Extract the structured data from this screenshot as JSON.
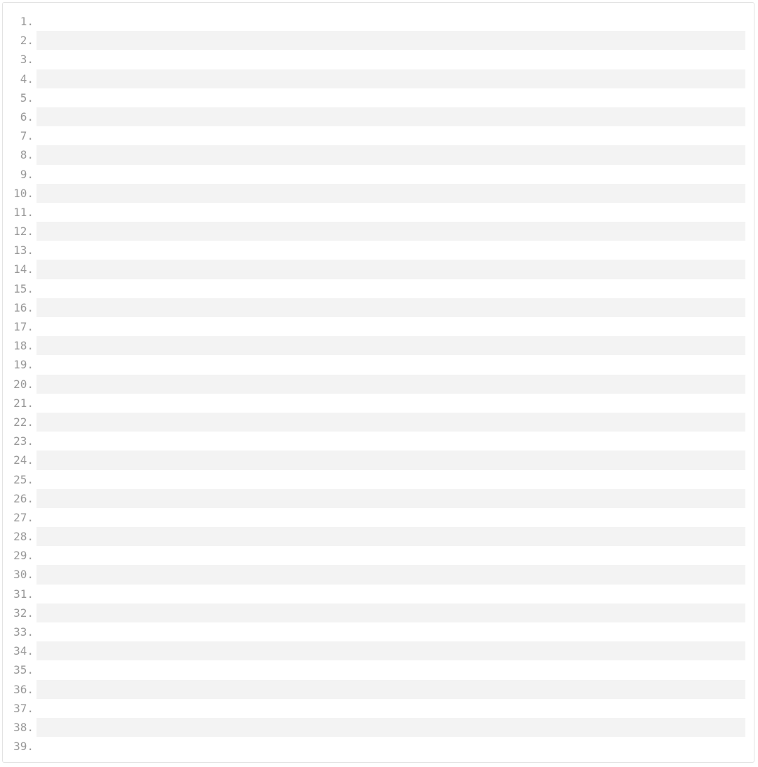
{
  "theme": {
    "text_color": "#222222",
    "line_number_color": "#999999",
    "stripe_color": "#f3f3f3"
  },
  "code": {
    "lines": [
      "",
      "",
      "",
      "",
      "",
      "",
      "",
      "",
      "",
      "",
      "",
      "",
      "",
      "",
      "",
      "",
      "",
      "",
      "",
      "",
      "",
      "",
      "",
      "",
      "",
      "",
      "",
      "",
      "",
      "",
      "",
      "",
      "",
      "",
      "",
      "",
      "",
      "",
      ""
    ]
  }
}
